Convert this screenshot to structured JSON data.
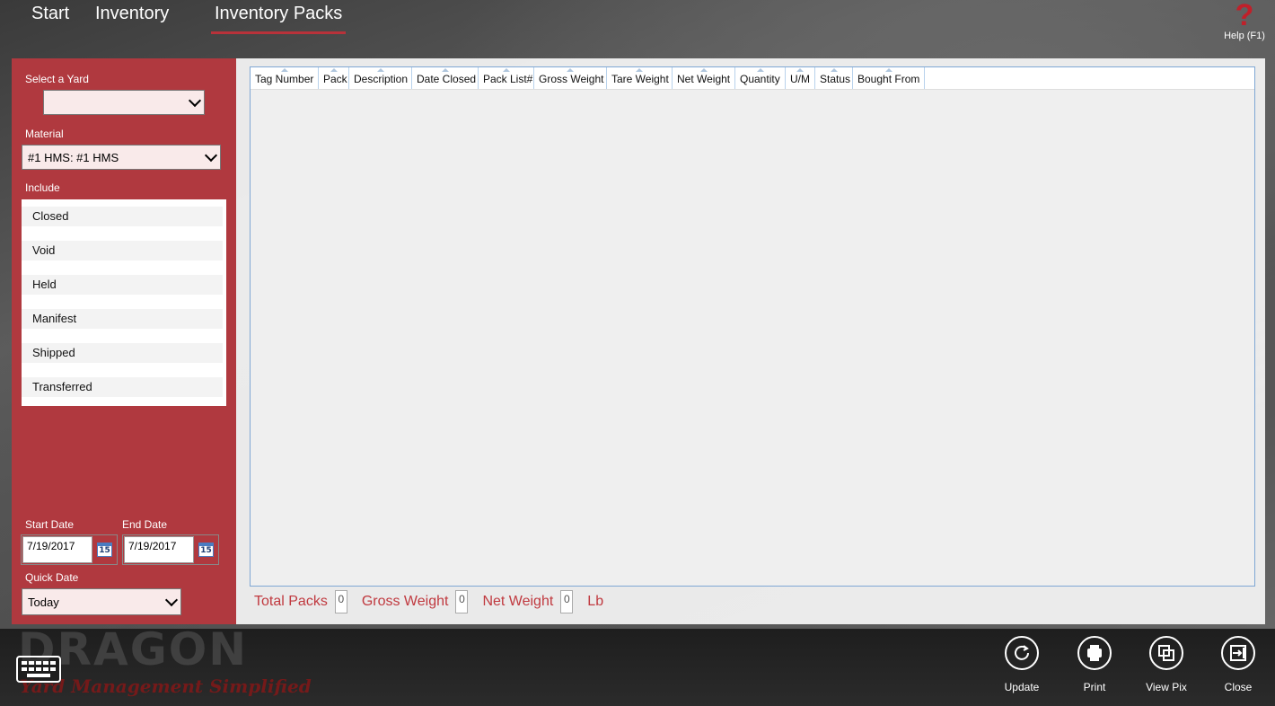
{
  "nav": {
    "items": [
      {
        "label": "Start"
      },
      {
        "label": "Inventory"
      },
      {
        "label": "Inventory Packs"
      }
    ],
    "help_label": "Help (F1)",
    "help_glyph": "?"
  },
  "filters": {
    "yard_label": "Select a Yard",
    "yard_value": "",
    "material_label": "Material",
    "material_value": "#1 HMS: #1 HMS",
    "include_label": "Include",
    "include_items": [
      "Closed",
      "Void",
      "Held",
      "Manifest",
      "Shipped",
      "Transferred"
    ],
    "start_date_label": "Start Date",
    "start_date_value": "7/19/2017",
    "end_date_label": "End Date",
    "end_date_value": "7/19/2017",
    "calendar_day": "15",
    "quick_date_label": "Quick Date",
    "quick_date_value": "Today"
  },
  "grid": {
    "columns": [
      "Tag Number",
      "Pack",
      "Description",
      "Date Closed",
      "Pack List#",
      "Gross Weight",
      "Tare Weight",
      "Net Weight",
      "Quantity",
      "U/M",
      "Status",
      "Bought From"
    ],
    "rows": []
  },
  "totals": {
    "total_packs_label": "Total Packs",
    "total_packs_value": "0",
    "gross_weight_label": "Gross Weight",
    "gross_weight_value": "0",
    "net_weight_label": "Net Weight",
    "net_weight_value": "0",
    "unit_label": "Lb"
  },
  "actions": [
    {
      "label": "Update",
      "icon": "refresh-icon"
    },
    {
      "label": "Print",
      "icon": "printer-icon"
    },
    {
      "label": "View Pix",
      "icon": "copy-icon"
    },
    {
      "label": "Close",
      "icon": "exit-icon"
    }
  ],
  "brand": {
    "name": "DRAGON",
    "tagline": "Yard Management Simplified"
  },
  "colors": {
    "accent": "#b0393f",
    "label_red": "#c0393f",
    "grid_border": "#7fa7d4"
  }
}
